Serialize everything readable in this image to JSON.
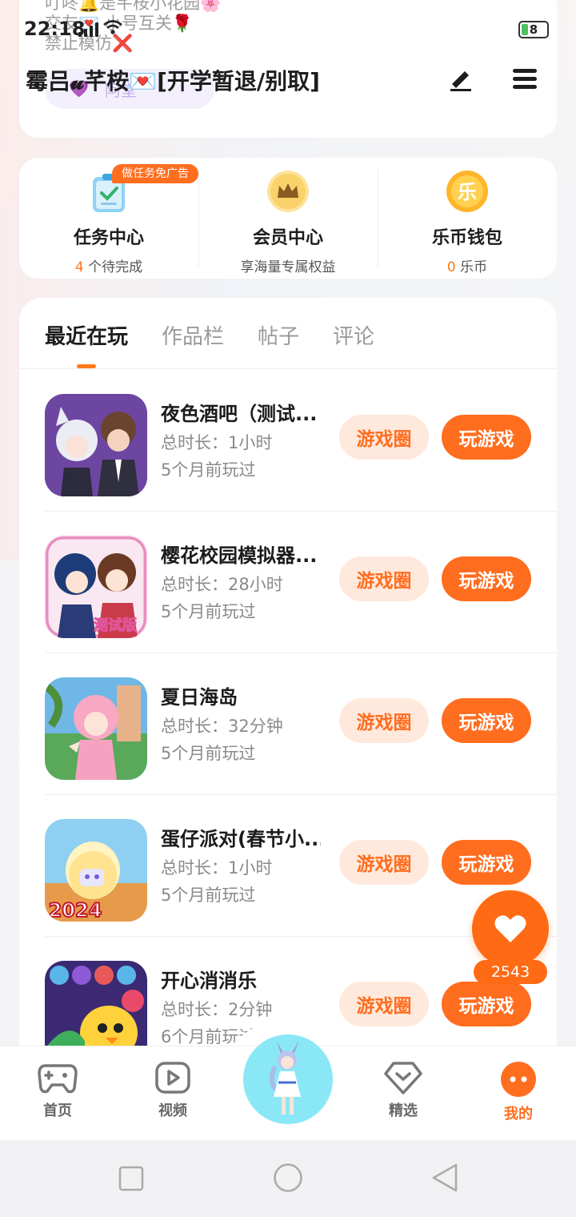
{
  "status_bar": {
    "time": "22:18",
    "network": "4G",
    "battery": "8"
  },
  "profile": {
    "bio": "叮咚🔔是芊桉小花园🌸\n交友💌 小号互关🌹\n禁止模仿❌",
    "name": "霉吕𝓾芊桉💌[开学暂退/别取]",
    "follow_pill_text": "阿堂"
  },
  "quick_actions": [
    {
      "title": "任务中心",
      "sub_num": "4",
      "sub_text": "个待完成",
      "badge": "做任务免广告",
      "icon": "task-clipboard-icon"
    },
    {
      "title": "会员中心",
      "sub_num": "",
      "sub_text": "享海量专属权益",
      "icon": "crown-icon"
    },
    {
      "title": "乐币钱包",
      "sub_num": "0",
      "sub_text": "乐币",
      "icon": "lebi-coin-icon"
    }
  ],
  "tabs": [
    "最近在玩",
    "作品栏",
    "帖子",
    "评论"
  ],
  "games": [
    {
      "name": "夜色酒吧（测试...",
      "time": "总时长：1小时",
      "ago": "5个月前玩过"
    },
    {
      "name": "樱花校园模拟器...",
      "time": "总时长：28小时",
      "ago": "5个月前玩过"
    },
    {
      "name": "夏日海岛",
      "time": "总时长：32分钟",
      "ago": "5个月前玩过"
    },
    {
      "name": "蛋仔派对(春节小...",
      "time": "总时长：1小时",
      "ago": "5个月前玩过"
    },
    {
      "name": "开心消消乐",
      "time": "总时长：2分钟",
      "ago": "6个月前玩过"
    }
  ],
  "buttons": {
    "circle": "游戏圈",
    "play": "玩游戏"
  },
  "like": {
    "count": "2543"
  },
  "thumb_labels": {
    "g2": "测试版",
    "g4": "2024"
  },
  "nav": {
    "home": "首页",
    "video": "视频",
    "featured": "精选",
    "mine": "我的"
  },
  "colors": {
    "accent": "#ff6d1f",
    "accent_light": "#ffe9dc"
  }
}
